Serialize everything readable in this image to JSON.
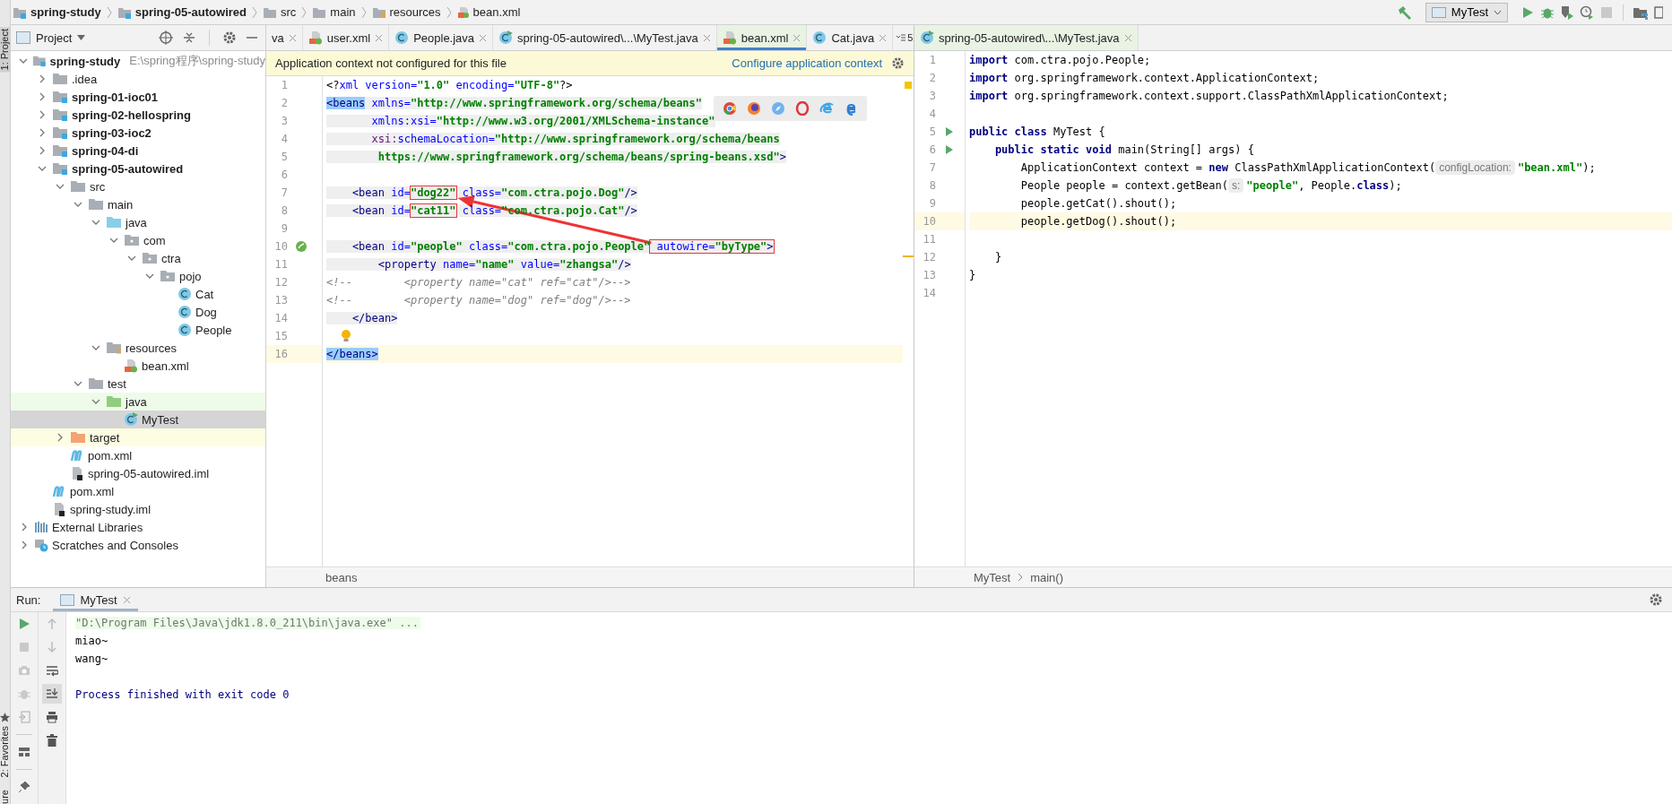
{
  "breadcrumb": [
    {
      "label": "spring-study",
      "kind": "module",
      "bold": true
    },
    {
      "label": "spring-05-autowired",
      "kind": "module",
      "bold": true
    },
    {
      "label": "src",
      "kind": "folder",
      "bold": false
    },
    {
      "label": "main",
      "kind": "folder",
      "bold": false
    },
    {
      "label": "resources",
      "kind": "resources",
      "bold": false
    },
    {
      "label": "bean.xml",
      "kind": "xml",
      "bold": false
    }
  ],
  "run_config": {
    "label": "MyTest"
  },
  "project": {
    "title": "Project",
    "tree": [
      {
        "label": "spring-study",
        "kind": "module",
        "note": "E:\\spring程序\\spring-study",
        "expanded": true,
        "selected": false,
        "children": [
          {
            "label": ".idea",
            "kind": "folder",
            "expanded": false,
            "selected": false
          },
          {
            "label": "spring-01-ioc01",
            "kind": "module",
            "expanded": false,
            "selected": false
          },
          {
            "label": "spring-02-hellospring",
            "kind": "module",
            "expanded": false,
            "selected": false
          },
          {
            "label": "spring-03-ioc2",
            "kind": "module",
            "expanded": false,
            "selected": false
          },
          {
            "label": "spring-04-di",
            "kind": "module",
            "expanded": false,
            "selected": false
          },
          {
            "label": "spring-05-autowired",
            "kind": "module",
            "expanded": true,
            "selected": false,
            "children": [
              {
                "label": "src",
                "kind": "folder",
                "expanded": true,
                "selected": false,
                "children": [
                  {
                    "label": "main",
                    "kind": "folder",
                    "expanded": true,
                    "selected": false,
                    "children": [
                      {
                        "label": "java",
                        "kind": "source",
                        "expanded": true,
                        "selected": false,
                        "children": [
                          {
                            "label": "com",
                            "kind": "package",
                            "expanded": true,
                            "selected": false,
                            "children": [
                              {
                                "label": "ctra",
                                "kind": "package",
                                "expanded": true,
                                "selected": false,
                                "children": [
                                  {
                                    "label": "pojo",
                                    "kind": "package",
                                    "expanded": true,
                                    "selected": false,
                                    "children": [
                                      {
                                        "label": "Cat",
                                        "kind": "class",
                                        "selected": false
                                      },
                                      {
                                        "label": "Dog",
                                        "kind": "class",
                                        "selected": false
                                      },
                                      {
                                        "label": "People",
                                        "kind": "class",
                                        "selected": false
                                      }
                                    ]
                                  }
                                ]
                              }
                            ]
                          }
                        ]
                      },
                      {
                        "label": "resources",
                        "kind": "resources",
                        "expanded": true,
                        "selected": false,
                        "children": [
                          {
                            "label": "bean.xml",
                            "kind": "xml",
                            "selected": false
                          }
                        ]
                      }
                    ]
                  },
                  {
                    "label": "test",
                    "kind": "folder",
                    "expanded": true,
                    "selected": false,
                    "children": [
                      {
                        "label": "java",
                        "kind": "test-source",
                        "expanded": true,
                        "selected": false,
                        "children": [
                          {
                            "label": "MyTest",
                            "kind": "test-class",
                            "selected": true
                          }
                        ]
                      }
                    ]
                  }
                ]
              },
              {
                "label": "target",
                "kind": "excluded",
                "expanded": false,
                "selected": false
              },
              {
                "label": "pom.xml",
                "kind": "maven",
                "selected": false
              },
              {
                "label": "spring-05-autowired.iml",
                "kind": "iml",
                "selected": false
              }
            ]
          },
          {
            "label": "pom.xml",
            "kind": "maven",
            "selected": false
          },
          {
            "label": "spring-study.iml",
            "kind": "iml",
            "selected": false
          }
        ]
      },
      {
        "label": "External Libraries",
        "kind": "libraries",
        "expanded": false,
        "selected": false
      },
      {
        "label": "Scratches and Consoles",
        "kind": "scratches",
        "expanded": false,
        "selected": false
      }
    ]
  },
  "editor_tabs": [
    {
      "label": "va",
      "selected": false
    },
    {
      "label": "user.xml",
      "kind": "xml",
      "selected": false
    },
    {
      "label": "People.java",
      "kind": "class",
      "selected": false
    },
    {
      "label": "spring-05-autowired\\...\\MyTest.java",
      "kind": "test-class",
      "selected": false
    },
    {
      "label": "bean.xml",
      "kind": "xml",
      "selected": true
    },
    {
      "label": "Cat.java",
      "kind": "class",
      "selected": false
    }
  ],
  "tab_overflow": "5",
  "notification": {
    "text": "Application context not configured for this file",
    "link": "Configure application context"
  },
  "xml_editor": {
    "footer": "beans",
    "lines": [
      {
        "number": "1",
        "shaded": false,
        "tokens": [
          {
            "kind": "plain",
            "text": "<?"
          },
          {
            "kind": "attr",
            "text": "xml version="
          },
          {
            "kind": "value",
            "text": "\"1.0\""
          },
          {
            "kind": "attr",
            "text": " encoding="
          },
          {
            "kind": "value",
            "text": "\"UTF-8\""
          },
          {
            "kind": "plain",
            "text": "?>"
          }
        ]
      },
      {
        "number": "2",
        "shaded": true,
        "tokens": [
          {
            "kind": "tag-match",
            "text": "<beans"
          },
          {
            "kind": "attr",
            "text": " xmlns="
          },
          {
            "kind": "value",
            "text": "\"http://www.springframework.org/schema/beans\""
          }
        ]
      },
      {
        "number": "3",
        "shaded": true,
        "tokens": [
          {
            "kind": "attr",
            "text": "       xmlns:xsi="
          },
          {
            "kind": "value",
            "text": "\"http://www.w3.org/2001/XMLSchema-instance\""
          }
        ]
      },
      {
        "number": "4",
        "shaded": true,
        "tokens": [
          {
            "kind": "ns",
            "text": "       xsi:"
          },
          {
            "kind": "attr",
            "text": "schemaLocation="
          },
          {
            "kind": "value",
            "text": "\"http://www.springframework.org/schema/beans"
          }
        ]
      },
      {
        "number": "5",
        "shaded": true,
        "tokens": [
          {
            "kind": "value",
            "text": "        https://www.springframework.org/schema/beans/spring-beans.xsd\""
          },
          {
            "kind": "tag",
            "text": ">"
          }
        ]
      },
      {
        "number": "6"
      },
      {
        "number": "7",
        "shaded": true,
        "tokens": [
          {
            "kind": "tag",
            "text": "    <bean"
          },
          {
            "kind": "attr",
            "text": " id="
          },
          {
            "kind": "value",
            "text": "\"dog22\"",
            "boxed": true
          },
          {
            "kind": "attr",
            "text": " class="
          },
          {
            "kind": "value",
            "text": "\"com.ctra.pojo.Dog\""
          },
          {
            "kind": "tag",
            "text": "/>"
          }
        ]
      },
      {
        "number": "8",
        "shaded": true,
        "tokens": [
          {
            "kind": "tag",
            "text": "    <bean"
          },
          {
            "kind": "attr",
            "text": " id="
          },
          {
            "kind": "value",
            "text": "\"cat11\"",
            "boxed": true
          },
          {
            "kind": "attr",
            "text": " class="
          },
          {
            "kind": "value",
            "text": "\"com.ctra.pojo.Cat\""
          },
          {
            "kind": "tag",
            "text": "/>"
          }
        ]
      },
      {
        "number": "9"
      },
      {
        "number": "10",
        "kind": "bean",
        "shaded": true,
        "tokens": [
          {
            "kind": "tag",
            "text": "    <bean"
          },
          {
            "kind": "attr",
            "text": " id="
          },
          {
            "kind": "value",
            "text": "\"people\""
          },
          {
            "kind": "attr",
            "text": " class="
          },
          {
            "kind": "value",
            "text": "\"com.ctra.pojo.People\""
          },
          {
            "kind": "attr",
            "text": " autowire=",
            "boxed": true
          },
          {
            "kind": "value",
            "text": "\"byType\"",
            "boxed": true
          },
          {
            "kind": "tag",
            "text": ">",
            "boxed": true
          }
        ]
      },
      {
        "number": "11",
        "shaded": true,
        "tokens": [
          {
            "kind": "tag",
            "text": "        <property"
          },
          {
            "kind": "attr",
            "text": " name="
          },
          {
            "kind": "value",
            "text": "\"name\""
          },
          {
            "kind": "attr",
            "text": " value="
          },
          {
            "kind": "value",
            "text": "\"zhangsa\""
          },
          {
            "kind": "tag",
            "text": "/>"
          }
        ]
      },
      {
        "number": "12",
        "shaded": false,
        "tokens": [
          {
            "kind": "comment",
            "text": "<!--        <property name=\"cat\" ref=\"cat\"/>-->"
          }
        ]
      },
      {
        "number": "13",
        "shaded": false,
        "tokens": [
          {
            "kind": "comment",
            "text": "<!--        <property name=\"dog\" ref=\"dog\"/>-->"
          }
        ]
      },
      {
        "number": "14",
        "shaded": true,
        "tokens": [
          {
            "kind": "tag",
            "text": "    </bean>"
          }
        ]
      },
      {
        "number": "15",
        "kind": "bulb"
      },
      {
        "number": "16",
        "current": true,
        "shaded": false,
        "tokens": [
          {
            "kind": "tag-match",
            "text": "</beans>"
          }
        ]
      }
    ]
  },
  "java_editor": {
    "tab": {
      "label": "spring-05-autowired\\...\\MyTest.java",
      "selected": true
    },
    "footer": [
      "MyTest",
      "main()"
    ],
    "lines": [
      {
        "number": "1",
        "tokens": [
          {
            "kind": "keyword",
            "text": "import"
          },
          {
            "kind": "plain",
            "text": " com.ctra.pojo.People;"
          }
        ]
      },
      {
        "number": "2",
        "tokens": [
          {
            "kind": "keyword",
            "text": "import"
          },
          {
            "kind": "plain",
            "text": " org.springframework.context.ApplicationContext;"
          }
        ]
      },
      {
        "number": "3",
        "tokens": [
          {
            "kind": "keyword",
            "text": "import"
          },
          {
            "kind": "plain",
            "text": " org.springframework.context.support.ClassPathXmlApplicationContext;"
          }
        ]
      },
      {
        "number": "4"
      },
      {
        "number": "5",
        "kind": "run",
        "tokens": [
          {
            "kind": "keyword",
            "text": "public class"
          },
          {
            "kind": "plain",
            "text": " MyTest {"
          }
        ]
      },
      {
        "number": "6",
        "kind": "run",
        "tokens": [
          {
            "kind": "keyword",
            "text": "    public static void"
          },
          {
            "kind": "plain",
            "text": " main(String[] args) {"
          }
        ]
      },
      {
        "number": "7",
        "tokens": [
          {
            "kind": "plain",
            "text": "        ApplicationContext context = "
          },
          {
            "kind": "keyword",
            "text": "new"
          },
          {
            "kind": "plain",
            "text": " ClassPathXmlApplicationContext("
          },
          {
            "kind": "hint",
            "text": "configLocation:"
          },
          {
            "kind": "string",
            "text": "\"bean.xml\""
          },
          {
            "kind": "plain",
            "text": ");"
          }
        ]
      },
      {
        "number": "8",
        "tokens": [
          {
            "kind": "plain",
            "text": "        People people = context.getBean("
          },
          {
            "kind": "hint",
            "text": "s:"
          },
          {
            "kind": "string",
            "text": "\"people\""
          },
          {
            "kind": "plain",
            "text": ", People."
          },
          {
            "kind": "keyword",
            "text": "class"
          },
          {
            "kind": "plain",
            "text": ");"
          }
        ]
      },
      {
        "number": "9",
        "tokens": [
          {
            "kind": "plain",
            "text": "        people.getCat().shout();"
          }
        ]
      },
      {
        "number": "10",
        "current": true,
        "tokens": [
          {
            "kind": "plain",
            "text": "        people.getDog().shout();"
          }
        ]
      },
      {
        "number": "11"
      },
      {
        "number": "12",
        "tokens": [
          {
            "kind": "plain",
            "text": "    }"
          }
        ]
      },
      {
        "number": "13",
        "tokens": [
          {
            "kind": "plain",
            "text": "}"
          }
        ]
      },
      {
        "number": "14"
      }
    ]
  },
  "run_panel": {
    "label": "Run:",
    "tab": {
      "label": "MyTest",
      "selected": true
    },
    "output": [
      {
        "kind": "command",
        "text": "\"D:\\Program Files\\Java\\jdk1.8.0_211\\bin\\java.exe\" ..."
      },
      {
        "kind": "normal",
        "text": "miao~"
      },
      {
        "kind": "normal",
        "text": "wang~"
      },
      {
        "kind": "blank"
      },
      {
        "kind": "exit",
        "text": "Process finished with exit code 0"
      }
    ]
  },
  "side_strip": {
    "top": "1: Project",
    "favorites": "2: Favorites",
    "bottom": "ure"
  }
}
